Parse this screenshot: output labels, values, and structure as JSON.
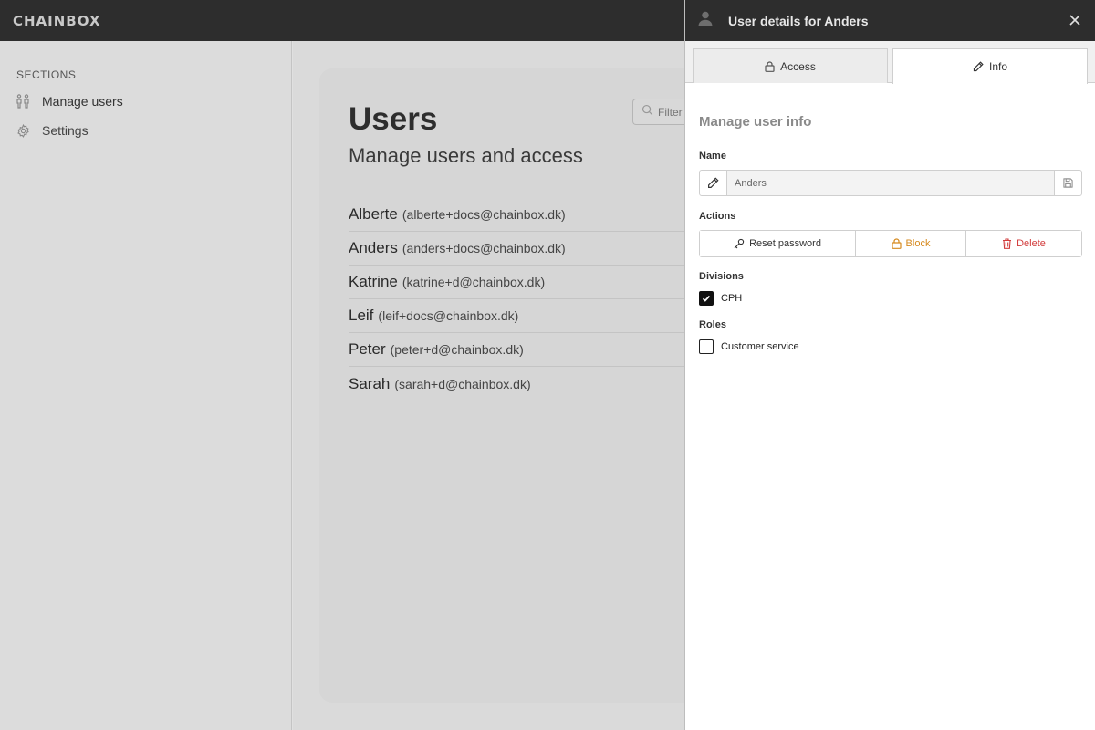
{
  "app": {
    "logo": "CHAINBOX"
  },
  "sidebar": {
    "section_title": "SECTIONS",
    "items": [
      {
        "label": "Manage users",
        "icon": "users-icon"
      },
      {
        "label": "Settings",
        "icon": "gear-icon"
      }
    ]
  },
  "main": {
    "title": "Users",
    "subtitle": "Manage users and access",
    "filter_placeholder": "Filter",
    "users": [
      {
        "name": "Alberte",
        "email": "(alberte+docs@chainbox.dk)"
      },
      {
        "name": "Anders",
        "email": "(anders+docs@chainbox.dk)"
      },
      {
        "name": "Katrine",
        "email": "(katrine+d@chainbox.dk)"
      },
      {
        "name": "Leif",
        "email": "(leif+docs@chainbox.dk)"
      },
      {
        "name": "Peter",
        "email": "(peter+d@chainbox.dk)"
      },
      {
        "name": "Sarah",
        "email": "(sarah+d@chainbox.dk)"
      }
    ]
  },
  "panel": {
    "title": "User details for Anders",
    "tabs": [
      {
        "label": "Access",
        "icon": "lock-icon"
      },
      {
        "label": "Info",
        "icon": "pencil-icon",
        "active": true
      }
    ],
    "section_heading": "Manage user info",
    "name_label": "Name",
    "name_value": "Anders",
    "actions_label": "Actions",
    "actions": {
      "reset": "Reset password",
      "block": "Block",
      "delete": "Delete"
    },
    "divisions_label": "Divisions",
    "divisions": [
      {
        "label": "CPH",
        "checked": true
      }
    ],
    "roles_label": "Roles",
    "roles": [
      {
        "label": "Customer service",
        "checked": false
      }
    ]
  },
  "colors": {
    "topbar": "#2d2d2d",
    "block": "#d68a1f",
    "delete": "#d23b3b"
  }
}
